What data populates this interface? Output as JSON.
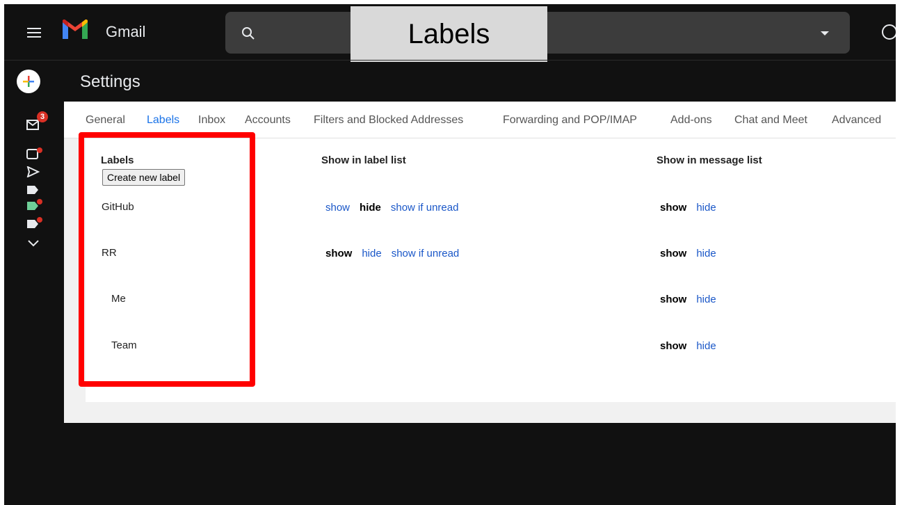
{
  "app": {
    "name": "Gmail"
  },
  "overlay": {
    "caption": "Labels"
  },
  "left_rail": {
    "inbox_badge": "3"
  },
  "settings": {
    "title": "Settings"
  },
  "tabs": [
    "General",
    "Labels",
    "Inbox",
    "Accounts",
    "Filters and Blocked Addresses",
    "Forwarding and POP/IMAP",
    "Add-ons",
    "Chat and Meet",
    "Advanced"
  ],
  "active_tab": "Labels",
  "labels_table": {
    "headers": {
      "labels": "Labels",
      "label_list": "Show in label list",
      "message_list": "Show in message list"
    },
    "create_button": "Create new label",
    "rows": [
      {
        "name": "GitHub",
        "label_list": [
          "show",
          "hide",
          "show if unread"
        ],
        "label_list_current": "hide",
        "message_list": [
          "show",
          "hide"
        ],
        "message_list_current": "show"
      },
      {
        "name": "RR",
        "label_list": [
          "show",
          "hide",
          "show if unread"
        ],
        "label_list_current": "show",
        "message_list": [
          "show",
          "hide"
        ],
        "message_list_current": "show"
      },
      {
        "name": "Me",
        "message_list": [
          "show",
          "hide"
        ],
        "message_list_current": "show"
      },
      {
        "name": "Team",
        "message_list": [
          "show",
          "hide"
        ],
        "message_list_current": "show"
      }
    ]
  },
  "colors": {
    "highlight": "#ff0000",
    "link": "#1a57c8",
    "active_tab": "#1a73e8",
    "badge": "#d93025"
  }
}
